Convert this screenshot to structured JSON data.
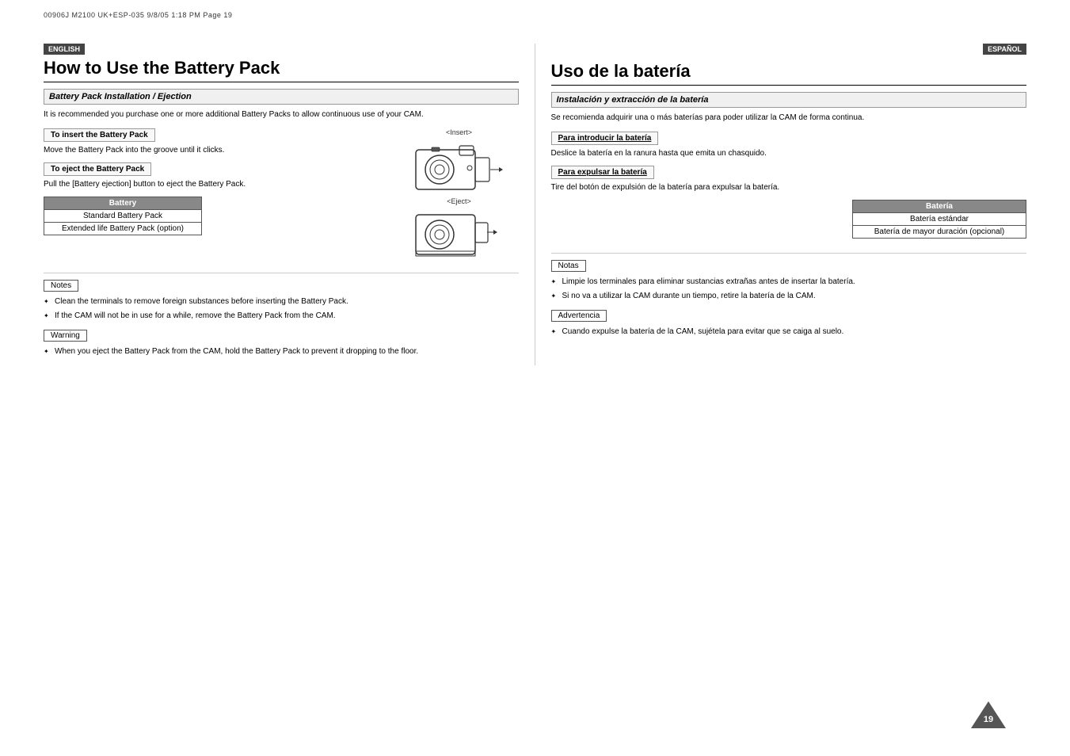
{
  "fileInfo": "00906J M2100 UK+ESP-035   9/8/05 1:18 PM   Page 19",
  "pageNumber": "19",
  "english": {
    "badge": "ENGLISH",
    "title": "How to Use the Battery Pack",
    "sectionHeader": "Battery Pack Installation / Ejection",
    "introText": "It is recommended you purchase one or more additional Battery Packs to allow continuous use of your CAM.",
    "insertHeader": "To insert the Battery Pack",
    "insertText": "Move the Battery Pack into the groove until it clicks.",
    "ejectHeader": "To eject the Battery Pack",
    "ejectText": "Pull the [Battery ejection] button to eject the Battery Pack.",
    "batteryTableHeader": "Battery",
    "batteryRow1": "Standard Battery Pack",
    "batteryRow2": "Extended life Battery Pack (option)",
    "insertLabel": "<Insert>",
    "ejectLabel": "<Eject>",
    "notesLabel": "Notes",
    "notesList": [
      "Clean the terminals to remove foreign substances before inserting the Battery Pack.",
      "If the CAM will not be in use for a while, remove the Battery Pack from the CAM."
    ],
    "warningLabel": "Warning",
    "warningList": [
      "When you eject the Battery Pack from the CAM, hold the Battery Pack to prevent it dropping to the floor."
    ]
  },
  "espanol": {
    "badge": "ESPAÑOL",
    "title": "Uso de la batería",
    "sectionHeader": "Instalación y extracción de la batería",
    "introText": "Se recomienda adquirir una o más baterías para poder utilizar la CAM de forma continua.",
    "insertHeader": "Para introducir la batería",
    "insertText": "Deslice la batería en la ranura hasta que emita un chasquido.",
    "ejectHeader": "Para expulsar la batería",
    "ejectText": "Tire del botón de expulsión de la batería para expulsar la batería.",
    "batteryTableHeader": "Batería",
    "batteryRow1": "Batería estándar",
    "batteryRow2": "Batería de mayor duración (opcional)",
    "notasLabel": "Notas",
    "notasList": [
      "Limpie los terminales para eliminar sustancias extrañas antes de insertar la batería.",
      "Si no va a utilizar la CAM durante un tiempo, retire la batería de la CAM."
    ],
    "advertenciaLabel": "Advertencia",
    "advertenciaList": [
      "Cuando expulse la batería de la CAM, sujétela para evitar que se caiga al suelo."
    ]
  }
}
